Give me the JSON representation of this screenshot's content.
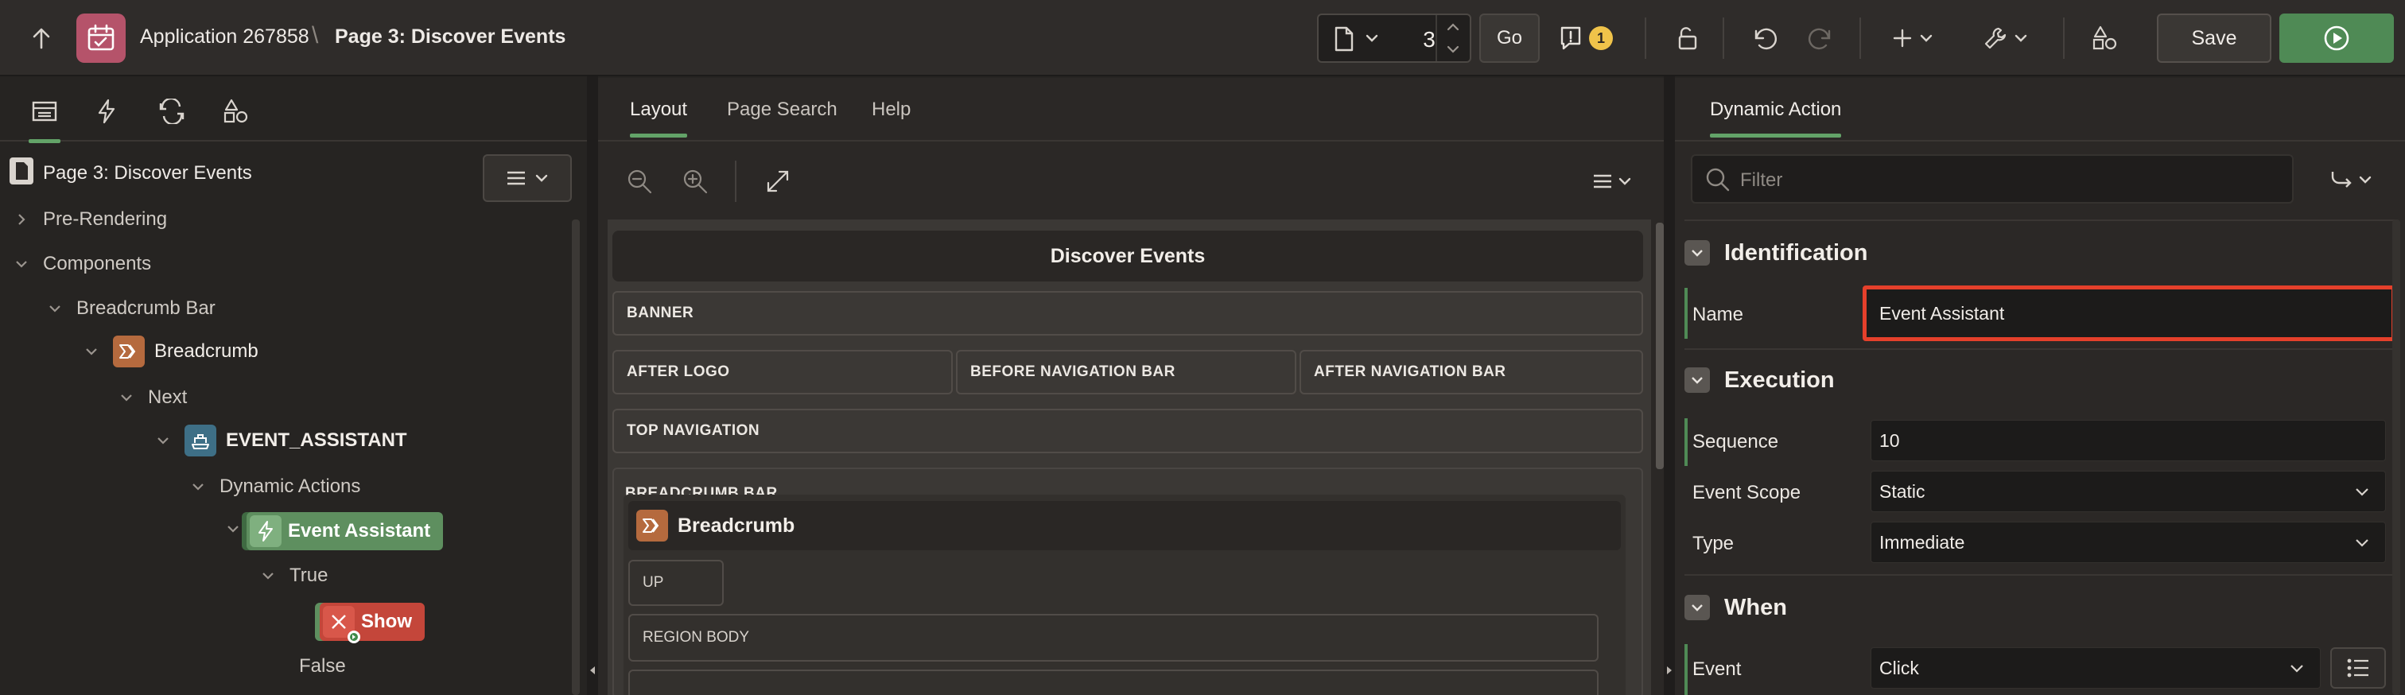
{
  "header": {
    "app_name": "Application 267858",
    "separator": "\\",
    "page_title": "Page 3: Discover Events",
    "page_number": "3",
    "go_label": "Go",
    "issues_count": "1",
    "save_label": "Save"
  },
  "left": {
    "tree_title": "Page 3: Discover Events",
    "nodes": {
      "pre_rendering": "Pre-Rendering",
      "components": "Components",
      "breadcrumb_bar": "Breadcrumb Bar",
      "breadcrumb": "Breadcrumb",
      "next": "Next",
      "event_assistant_item": "EVENT_ASSISTANT",
      "dynamic_actions": "Dynamic Actions",
      "event_assistant_da": "Event Assistant",
      "true_branch": "True",
      "show_action": "Show",
      "false_branch": "False"
    }
  },
  "center": {
    "tabs": [
      "Layout",
      "Page Search",
      "Help"
    ],
    "page_region": "Discover Events",
    "slots": {
      "banner": "BANNER",
      "after_logo": "AFTER LOGO",
      "before_nav": "BEFORE NAVIGATION BAR",
      "after_nav": "AFTER NAVIGATION BAR",
      "top_nav": "TOP NAVIGATION",
      "breadcrumb_bar": "BREADCRUMB BAR",
      "breadcrumb_region": "Breadcrumb",
      "up": "UP",
      "region_body": "REGION BODY"
    }
  },
  "right": {
    "tab": "Dynamic Action",
    "filter_placeholder": "Filter",
    "sections": {
      "identification": "Identification",
      "execution": "Execution",
      "when": "When"
    },
    "props": {
      "name_label": "Name",
      "name_value": "Event Assistant",
      "sequence_label": "Sequence",
      "sequence_value": "10",
      "scope_label": "Event Scope",
      "scope_value": "Static",
      "type_label": "Type",
      "type_value": "Immediate",
      "event_label": "Event",
      "event_value": "Click"
    }
  },
  "colors": {
    "accent_green": "#63a368",
    "run_button": "#4f8a55",
    "highlight_red": "#e5402b",
    "app_icon": "#b5536a",
    "breadcrumb_icon": "#b56a3e",
    "dynamic_action_pill": "#5e8f5f",
    "show_action_pill": "#c4463a",
    "item_icon": "#3e6f86",
    "warning_badge": "#f0c34a"
  }
}
